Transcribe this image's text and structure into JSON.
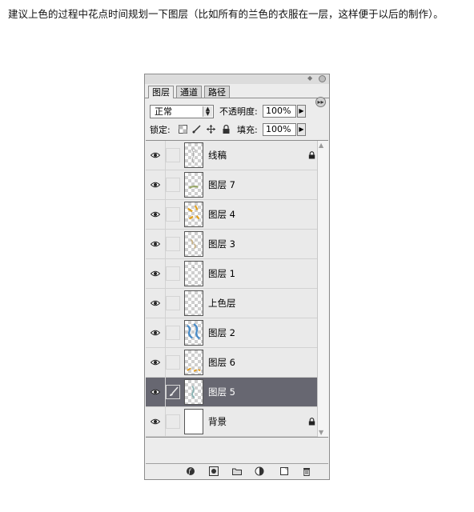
{
  "article": {
    "text": "建议上色的过程中花点时间规划一下图层（比如所有的兰色的衣服在一层，这样便于以后的制作）。"
  },
  "panel": {
    "tabs": [
      {
        "label": "图层",
        "active": true
      },
      {
        "label": "通道",
        "active": false
      },
      {
        "label": "路径",
        "active": false
      }
    ],
    "blend_mode": "正常",
    "opacity_label": "不透明度:",
    "opacity_value": "100%",
    "lock_label": "锁定:",
    "fill_label": "填充:",
    "fill_value": "100%",
    "layers": [
      {
        "name": "线稿",
        "visible": true,
        "locked": true,
        "selected": false,
        "thumb": "sketch"
      },
      {
        "name": "图层 7",
        "visible": true,
        "locked": false,
        "selected": false,
        "thumb": "green"
      },
      {
        "name": "图层 4",
        "visible": true,
        "locked": false,
        "selected": false,
        "thumb": "orange"
      },
      {
        "name": "图层 3",
        "visible": true,
        "locked": false,
        "selected": false,
        "thumb": "tan"
      },
      {
        "name": "图层 1",
        "visible": true,
        "locked": false,
        "selected": false,
        "thumb": "dot"
      },
      {
        "name": "上色层",
        "visible": true,
        "locked": false,
        "selected": false,
        "thumb": "faint"
      },
      {
        "name": "图层 2",
        "visible": true,
        "locked": false,
        "selected": false,
        "thumb": "blue"
      },
      {
        "name": "图层 6",
        "visible": true,
        "locked": false,
        "selected": false,
        "thumb": "orange-bottom"
      },
      {
        "name": "图层 5",
        "visible": true,
        "locked": false,
        "selected": true,
        "thumb": "teal"
      },
      {
        "name": "背景",
        "visible": true,
        "locked": true,
        "selected": false,
        "thumb": "white"
      }
    ],
    "bottom_icons": [
      "layer-style-icon",
      "layer-mask-icon",
      "new-group-icon",
      "adjustment-layer-icon",
      "new-layer-icon",
      "trash-icon"
    ],
    "colors": {
      "selected_row": "#676771",
      "panel_bg": "#ececec"
    }
  }
}
